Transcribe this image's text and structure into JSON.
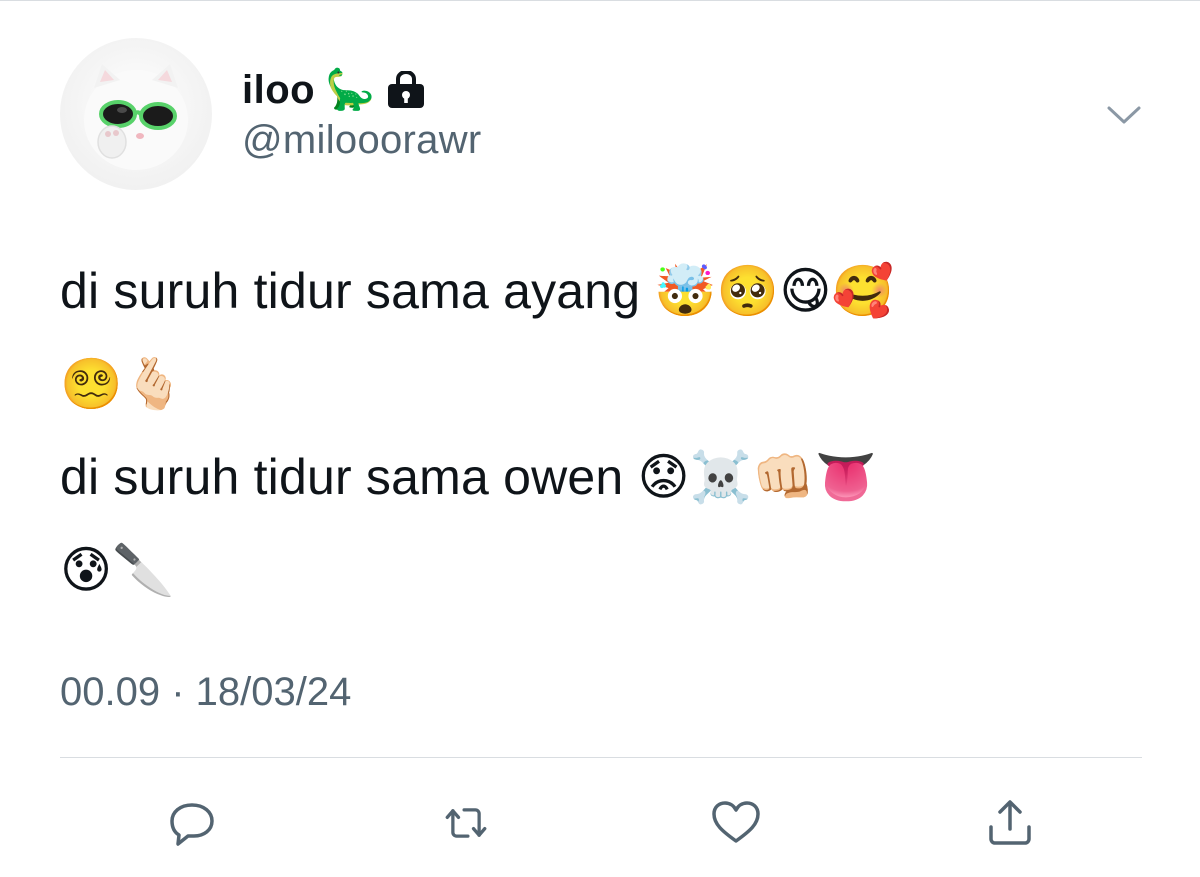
{
  "tweet": {
    "display_name": "iloo",
    "name_emoji": "🦕",
    "lock_icon": "lock-icon",
    "handle": "@milooorawr",
    "text": "di suruh tidur sama ayang 🤯🥺😋🥰\n😵‍💫🫰🏻\ndi suruh tidur sama owen 😟☠️👊🏻👅\n😰🔪",
    "timestamp": "00.09 · 18/03/24"
  },
  "actions": {
    "reply_icon": "reply-icon",
    "retweet_icon": "retweet-icon",
    "like_icon": "heart-icon",
    "share_icon": "share-icon"
  },
  "colors": {
    "text": "#0f1419",
    "secondary": "#536471",
    "divider": "#d9dde1"
  }
}
